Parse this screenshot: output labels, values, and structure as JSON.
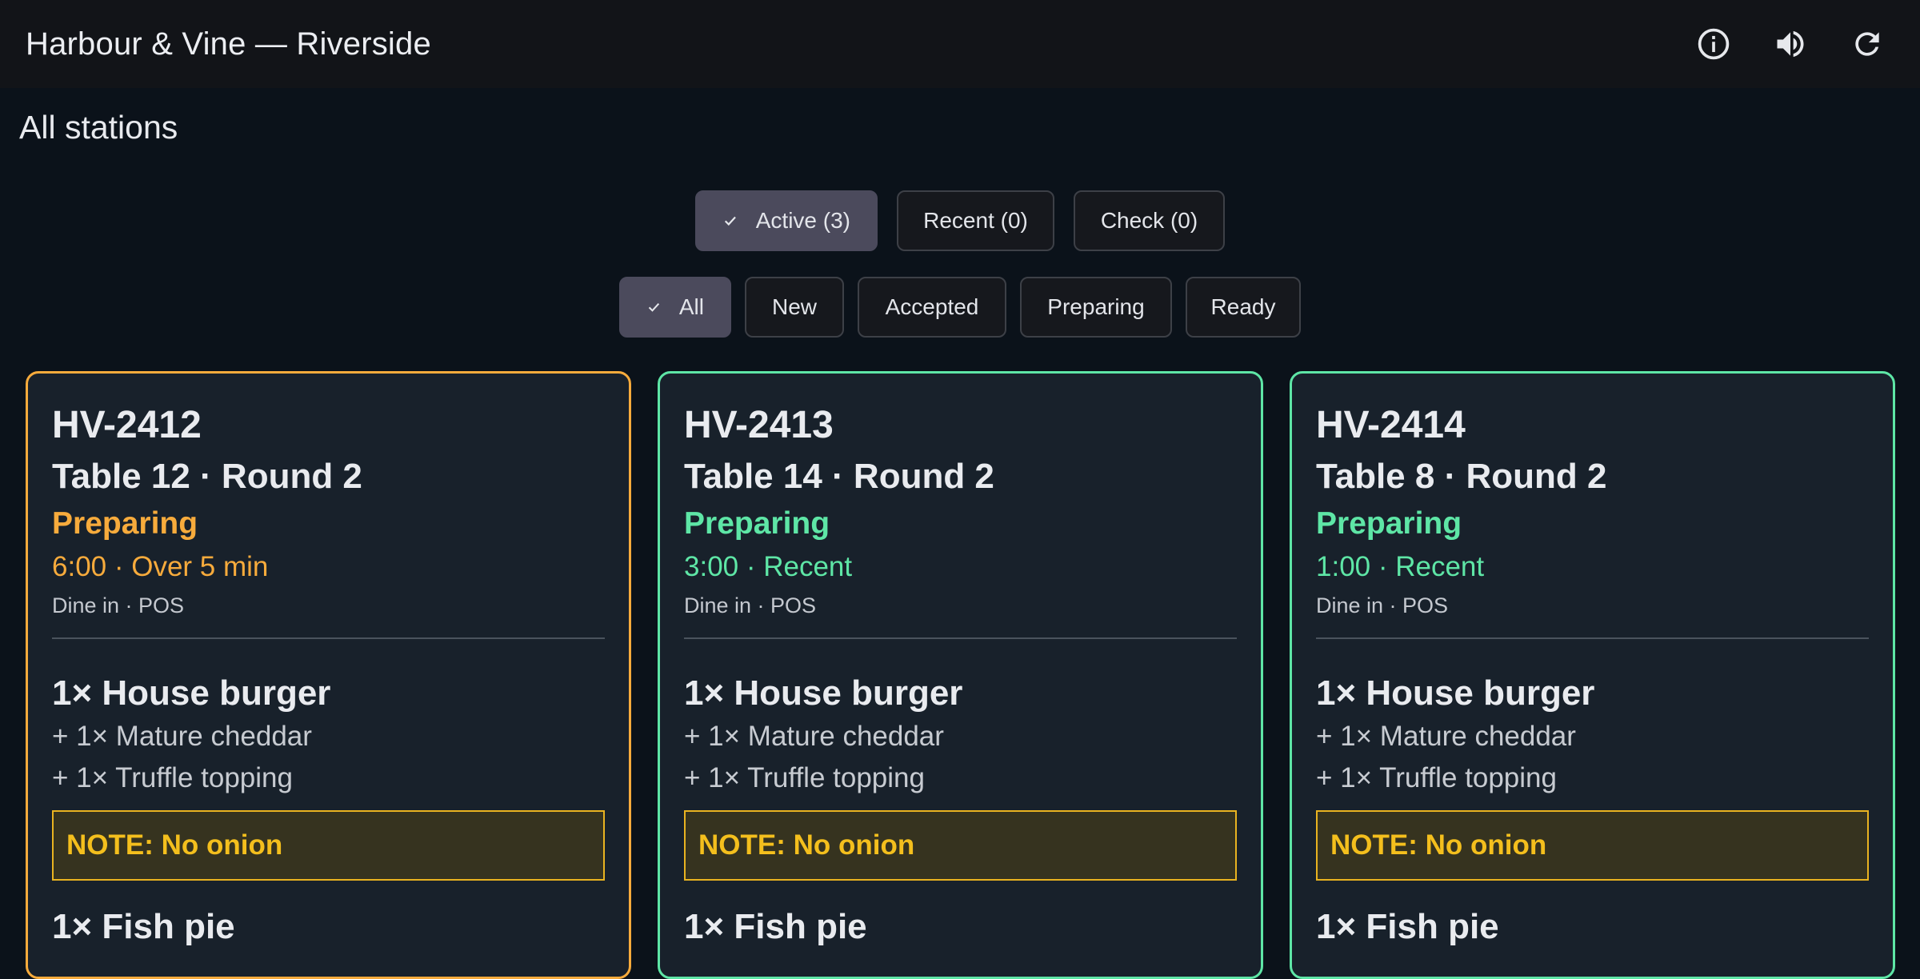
{
  "header": {
    "title": "Harbour & Vine — Riverside",
    "icons": [
      "info-icon",
      "volume-icon",
      "refresh-icon"
    ]
  },
  "station_title": "All stations",
  "view_tabs": [
    {
      "label": "Active (3)",
      "selected": true
    },
    {
      "label": "Recent (0)",
      "selected": false
    },
    {
      "label": "Check (0)",
      "selected": false
    }
  ],
  "status_filters": [
    {
      "label": "All",
      "selected": true
    },
    {
      "label": "New",
      "selected": false
    },
    {
      "label": "Accepted",
      "selected": false
    },
    {
      "label": "Preparing",
      "selected": false
    },
    {
      "label": "Ready",
      "selected": false
    }
  ],
  "colors": {
    "late_border": "#f7ab3c",
    "ok_border": "#5ee6a6",
    "note_text": "#f4bf1d"
  },
  "orders": [
    {
      "id": "HV-2412",
      "table_round": "Table 12 · Round 2",
      "status": "Preparing",
      "timer": "6:00 · Over 5 min",
      "source": "Dine in · POS",
      "items": [
        {
          "name": "1× House burger",
          "modifiers": [
            "+ 1× Mature cheddar",
            "+ 1× Truffle topping"
          ],
          "note": "NOTE: No onion"
        },
        {
          "name": "1× Fish pie"
        }
      ]
    },
    {
      "id": "HV-2413",
      "table_round": "Table 14 · Round 2",
      "status": "Preparing",
      "timer": "3:00 · Recent",
      "source": "Dine in · POS",
      "items": [
        {
          "name": "1× House burger",
          "modifiers": [
            "+ 1× Mature cheddar",
            "+ 1× Truffle topping"
          ],
          "note": "NOTE: No onion"
        },
        {
          "name": "1× Fish pie"
        }
      ]
    },
    {
      "id": "HV-2414",
      "table_round": "Table 8 · Round 2",
      "status": "Preparing",
      "timer": "1:00 · Recent",
      "source": "Dine in · POS",
      "items": [
        {
          "name": "1× House burger",
          "modifiers": [
            "+ 1× Mature cheddar",
            "+ 1× Truffle topping"
          ],
          "note": "NOTE: No onion"
        },
        {
          "name": "1× Fish pie"
        }
      ]
    }
  ]
}
